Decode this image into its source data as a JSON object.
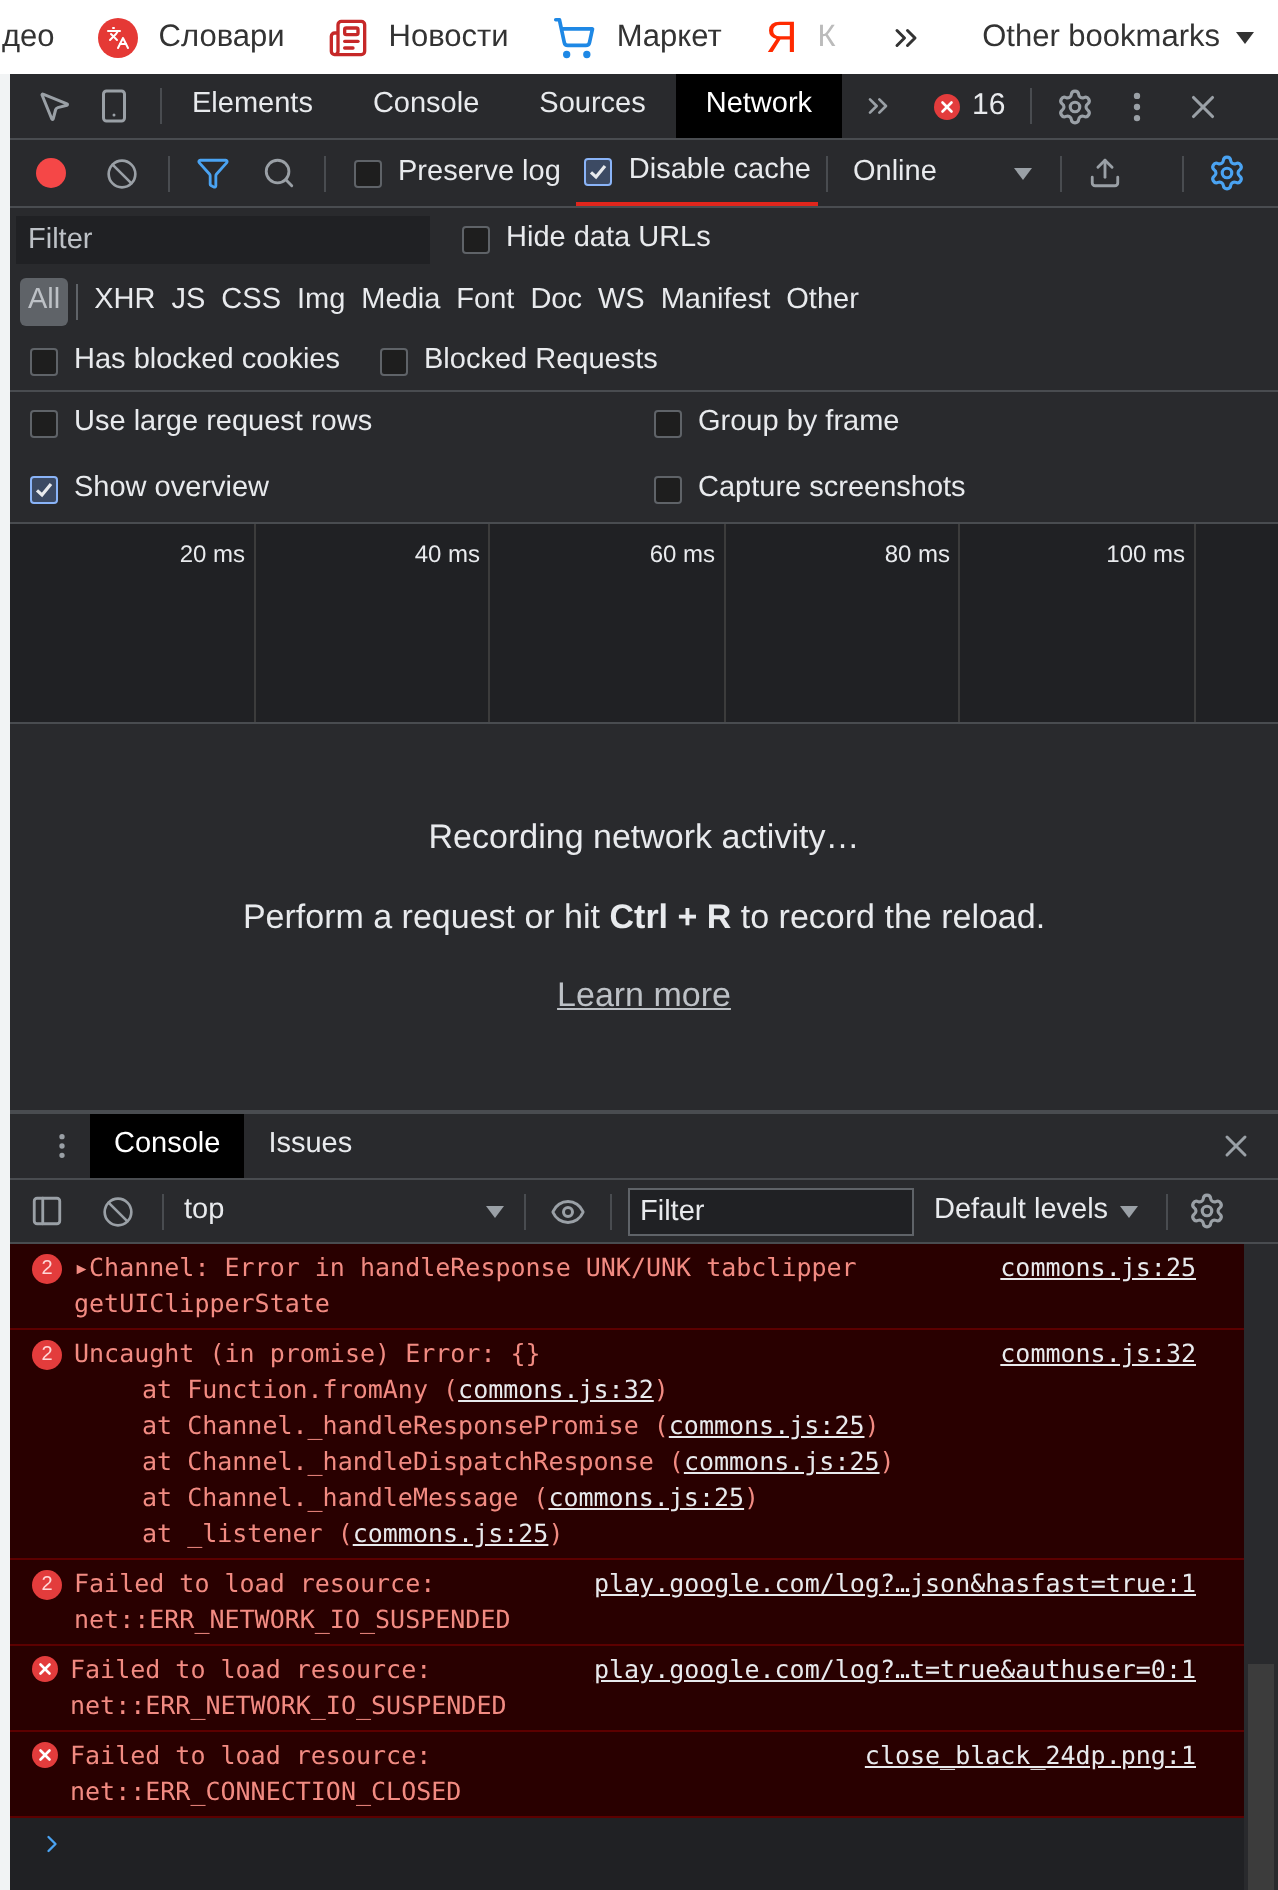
{
  "bookmarks": {
    "items": [
      {
        "kind": "plain",
        "label": "део"
      },
      {
        "kind": "translate",
        "label": "Словари"
      },
      {
        "kind": "news",
        "label": "Новости"
      },
      {
        "kind": "cart",
        "label": "Маркет"
      },
      {
        "kind": "letter",
        "icon_text": "Я",
        "label": "К"
      }
    ],
    "other": "Other bookmarks"
  },
  "tabs": [
    {
      "label": "Elements",
      "selected": false
    },
    {
      "label": "Console",
      "selected": false
    },
    {
      "label": "Sources",
      "selected": false
    },
    {
      "label": "Network",
      "selected": true
    }
  ],
  "error_count": "16",
  "network_toolbar": {
    "preserve_log": {
      "label": "Preserve log",
      "checked": false
    },
    "disable_cache": {
      "label": "Disable cache",
      "checked": true
    },
    "throttling": "Online"
  },
  "filter": {
    "placeholder": "Filter",
    "hide_data_urls": {
      "label": "Hide data URLs",
      "checked": false
    }
  },
  "types": [
    {
      "label": "All",
      "selected": true
    },
    {
      "label": "XHR",
      "selected": false
    },
    {
      "label": "JS",
      "selected": false
    },
    {
      "label": "CSS",
      "selected": false
    },
    {
      "label": "Img",
      "selected": false
    },
    {
      "label": "Media",
      "selected": false
    },
    {
      "label": "Font",
      "selected": false
    },
    {
      "label": "Doc",
      "selected": false
    },
    {
      "label": "WS",
      "selected": false
    },
    {
      "label": "Manifest",
      "selected": false
    },
    {
      "label": "Other",
      "selected": false
    }
  ],
  "blocked": [
    {
      "label": "Has blocked cookies",
      "checked": false
    },
    {
      "label": "Blocked Requests",
      "checked": false
    }
  ],
  "settings": [
    {
      "label": "Use large request rows",
      "checked": false
    },
    {
      "label": "Group by frame",
      "checked": false
    },
    {
      "label": "Show overview",
      "checked": true
    },
    {
      "label": "Capture screenshots",
      "checked": false
    }
  ],
  "timeline_ticks": [
    "20 ms",
    "40 ms",
    "60 ms",
    "80 ms",
    "100 ms"
  ],
  "empty_state": {
    "title": "Recording network activity…",
    "hint": "Perform a request or hit **Ctrl + R** to record the reload.",
    "link": "Learn more"
  },
  "drawer_tabs": [
    {
      "label": "Console",
      "selected": true
    },
    {
      "label": "Issues",
      "selected": false
    }
  ],
  "console_toolbar": {
    "context": "top",
    "filter_placeholder": "Filter",
    "levels": "Default levels"
  },
  "messages": [
    {
      "kind": "count",
      "count": "2",
      "lines": [
        "▸Channel: Error in handleResponse UNK/UNK tabclipper",
        "getUIClipperState"
      ],
      "source": "commons.js:25"
    },
    {
      "kind": "count",
      "count": "2",
      "lines": [
        "Uncaught (in promise) Error: {}"
      ],
      "source": "commons.js:32",
      "stack": [
        {
          "prefix": "at Function.fromAny (",
          "link": "commons.js:32",
          "suffix": ")"
        },
        {
          "prefix": "at Channel._handleResponsePromise (",
          "link": "commons.js:25",
          "suffix": ")"
        },
        {
          "prefix": "at Channel._handleDispatchResponse (",
          "link": "commons.js:25",
          "suffix": ")"
        },
        {
          "prefix": "at Channel._handleMessage (",
          "link": "commons.js:25",
          "suffix": ")"
        },
        {
          "prefix": "at _listener (",
          "link": "commons.js:25",
          "suffix": ")"
        }
      ]
    },
    {
      "kind": "count",
      "count": "2",
      "lines": [
        "Failed to load resource:",
        "net::ERR_NETWORK_IO_SUSPENDED"
      ],
      "source": "play.google.com/log?…json&hasfast=true:1"
    },
    {
      "kind": "error",
      "lines": [
        "Failed to load resource:",
        "net::ERR_NETWORK_IO_SUSPENDED"
      ],
      "source": "play.google.com/log?…t=true&authuser=0:1"
    },
    {
      "kind": "error",
      "lines": [
        "Failed to load resource:",
        "net::ERR_CONNECTION_CLOSED"
      ],
      "source": "close_black_24dp.png:1"
    }
  ]
}
